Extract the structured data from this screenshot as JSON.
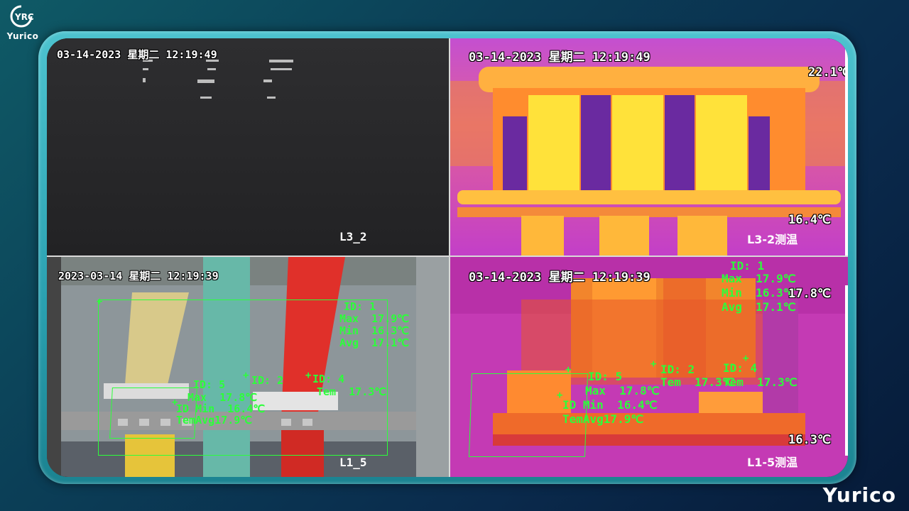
{
  "logo": {
    "mark": "YRC",
    "text": "Yurico"
  },
  "brand": "Yurico",
  "panes": [
    {
      "name": "L3_2",
      "timestamp": "03-14-2023 星期二 12:19:49",
      "label": "L3_2"
    },
    {
      "name": "L3-2 thermal",
      "timestamp": "03-14-2023 星期二 12:19:49",
      "label": "L3-2测温",
      "temp_max": "22.1℃",
      "temp_min": "16.4℃"
    },
    {
      "name": "L1_5",
      "timestamp": "2023-03-14 星期二 12:19:39",
      "label": "L1_5",
      "overlays": {
        "id1": "ID: 1",
        "id1_max": "Max  17.9℃",
        "id1_min": "Min  16.3℃",
        "id1_avg": "Avg  17.1℃",
        "id5": "ID: 5",
        "id2": "ID: 2",
        "id4": "ID: 4",
        "max": "Max  17.8℃",
        "tem": "Tem  17.3℃",
        "idmin": "ID Min  16.4℃",
        "temavg": "TemAvg17.9℃"
      }
    },
    {
      "name": "L1-5 thermal",
      "timestamp": "03-14-2023 星期二 12:19:39",
      "label": "L1-5测温",
      "temp_max": "17.8℃",
      "temp_min": "16.3℃",
      "overlays": {
        "id1": "ID: 1",
        "id1_max": "Max  17.9℃",
        "id1_min": "Min  16.3℃",
        "id1_avg": "Avg  17.1℃",
        "id5": "ID: 5",
        "id2": "ID: 2",
        "id4": "ID: 4",
        "max": "Max  17.8℃",
        "tem2": "Tem  17.3℃",
        "tem4": "Tem  17.3℃",
        "idmin": "ID Min  16.4℃",
        "temavg": "TemAvg17.9℃"
      }
    }
  ]
}
